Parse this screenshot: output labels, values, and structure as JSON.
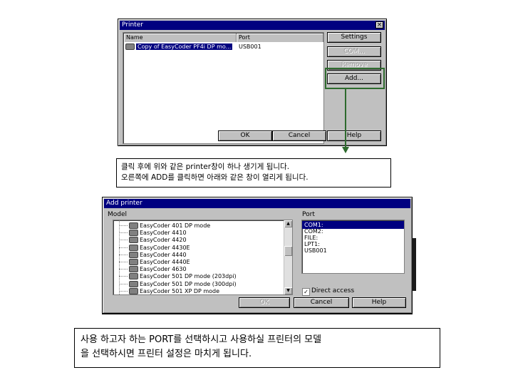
{
  "printer_dialog": {
    "title": "Printer",
    "close_glyph": "×",
    "col_name": "Name",
    "col_port": "Port",
    "printer_name": "Copy of EasyCoder PF4i DP mo...",
    "printer_port": "USB001",
    "buttons": {
      "settings": "Settings",
      "com": "COM...",
      "remove": "Remove",
      "add": "Add...",
      "ok": "OK",
      "cancel": "Cancel",
      "help": "Help"
    }
  },
  "caption1": {
    "line1": "클릭 후에 위와 같은 printer창이 하나 생기게 됩니다.",
    "line2": "오른쪽에 ADD를 클릭하면 아래와 같은 창이 열리게 됩니다."
  },
  "add_dialog": {
    "title": "Add printer",
    "model_label": "Model",
    "port_label": "Port",
    "models": [
      "EasyCoder 401 DP mode",
      "EasyCoder 4410",
      "EasyCoder 4420",
      "EasyCoder 4430E",
      "EasyCoder 4440",
      "EasyCoder 4440E",
      "EasyCoder 4630",
      "EasyCoder 501 DP mode (203dpi)",
      "EasyCoder 501 DP mode (300dpi)",
      "EasyCoder 501 XP DP mode"
    ],
    "ports": [
      "COM1:",
      "COM2:",
      "FILE:",
      "LPT1:",
      "USB001"
    ],
    "selected_port": "COM1:",
    "direct_access_label": "Direct access",
    "direct_access_checked": "✓",
    "buttons": {
      "ok": "OK",
      "cancel": "Cancel",
      "help": "Help"
    }
  },
  "caption2": {
    "line1": "사용 하고자 하는 PORT를 선택하시고 사용하실 프린터의 모델",
    "line2": "을 선택하시면 프린터 설정은 마치게 됩니다."
  },
  "colors": {
    "highlight_box": "#2e6b2e",
    "arrow": "#2e6b2e",
    "titlebar": "#000080"
  }
}
